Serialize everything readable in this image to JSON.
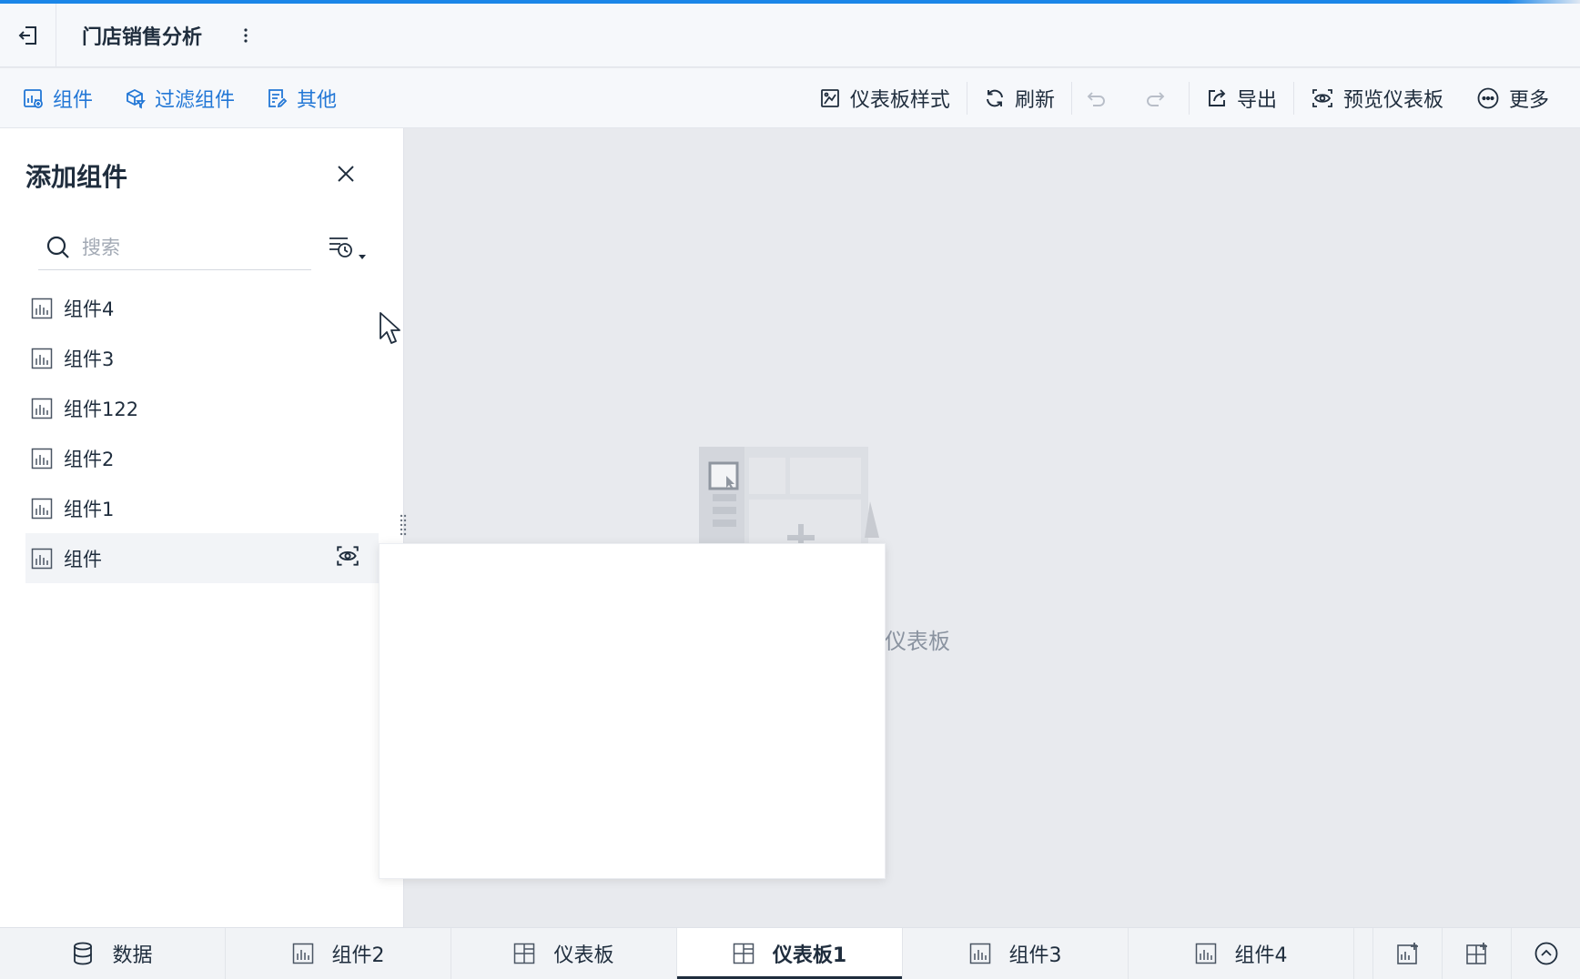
{
  "header": {
    "title": "门店销售分析"
  },
  "toolbar": {
    "left": [
      {
        "label": "组件",
        "icon": "add-chart-icon"
      },
      {
        "label": "过滤组件",
        "icon": "filter-cube-icon"
      },
      {
        "label": "其他",
        "icon": "edit-doc-icon"
      }
    ],
    "right": [
      {
        "label": "仪表板样式",
        "icon": "dashboard-style-icon"
      },
      {
        "label": "刷新",
        "icon": "refresh-icon"
      },
      {
        "label": "导出",
        "icon": "export-icon"
      },
      {
        "label": "预览仪表板",
        "icon": "eye-icon"
      },
      {
        "label": "更多",
        "icon": "more-circle-icon"
      }
    ]
  },
  "panel": {
    "title": "添加组件",
    "search_placeholder": "搜索",
    "items": [
      "组件4",
      "组件3",
      "组件122",
      "组件2",
      "组件1",
      "组件"
    ]
  },
  "canvas": {
    "empty_text": "仪表板"
  },
  "bottom_tabs": [
    {
      "label": "数据",
      "icon": "database-icon"
    },
    {
      "label": "组件2",
      "icon": "bar-chart-icon"
    },
    {
      "label": "仪表板",
      "icon": "dashboard-grid-icon"
    },
    {
      "label": "仪表板1",
      "icon": "dashboard-grid-icon",
      "active": true
    },
    {
      "label": "组件3",
      "icon": "bar-chart-icon"
    },
    {
      "label": "组件4",
      "icon": "bar-chart-icon"
    }
  ],
  "colors": {
    "accent": "#1b86e8",
    "link": "#2277d6",
    "text": "#1f2d3d",
    "canvas_bg": "#e8eaee"
  }
}
